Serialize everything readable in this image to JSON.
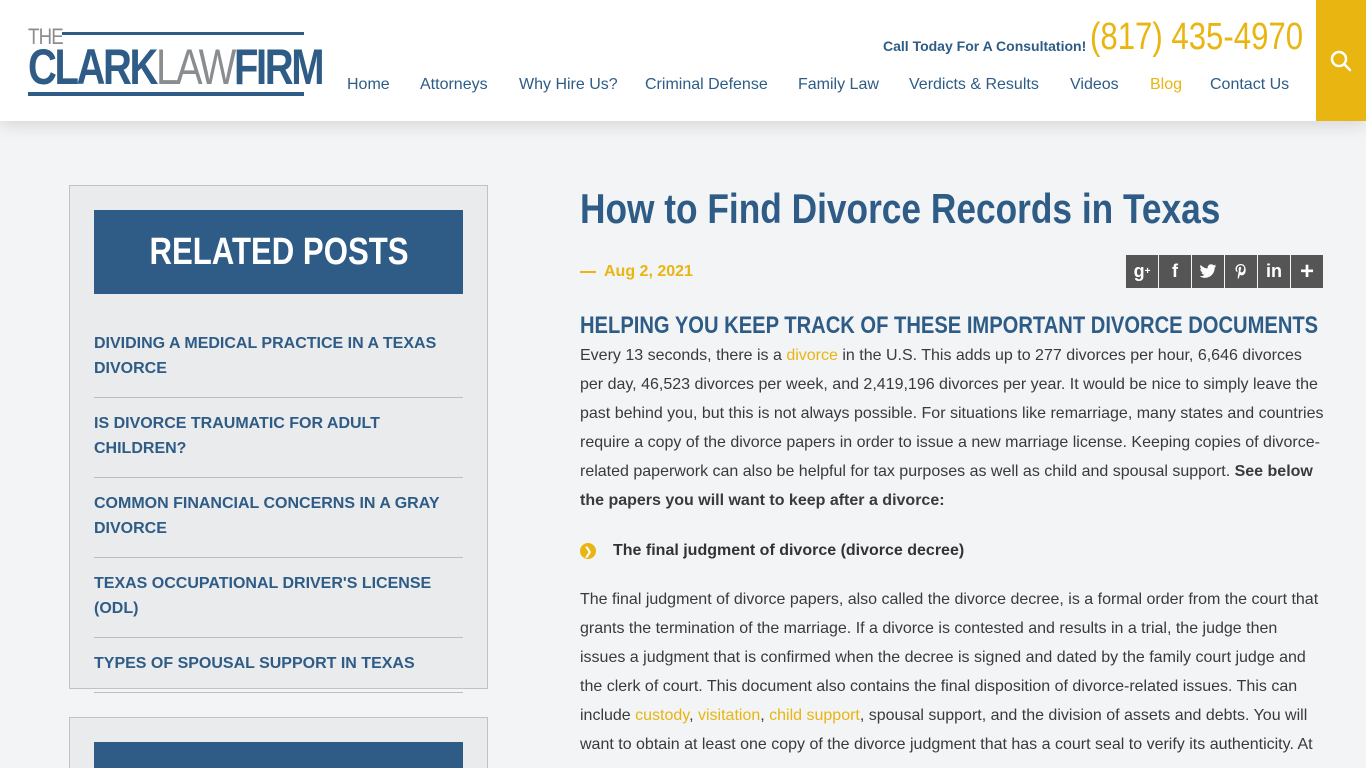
{
  "header": {
    "logo": {
      "the": "THE",
      "clark": "CLARK",
      "law": "LAW",
      "firm": "FIRM"
    },
    "cta_text": "Call Today For A Consultation!",
    "phone": "(817) 435-4970",
    "nav": [
      "Home",
      "Attorneys",
      "Why Hire Us?",
      "Criminal Defense",
      "Family Law",
      "Verdicts & Results",
      "Videos",
      "Blog",
      "Contact Us"
    ],
    "active_nav": "Blog",
    "search_icon": "search-icon"
  },
  "sidebar": {
    "title": "RELATED POSTS",
    "posts": [
      "DIVIDING A MEDICAL PRACTICE IN A TEXAS DIVORCE",
      "IS DIVORCE TRAUMATIC FOR ADULT CHILDREN?",
      "COMMON FINANCIAL CONCERNS IN A GRAY DIVORCE",
      "TEXAS OCCUPATIONAL DRIVER'S LICENSE (ODL)",
      "TYPES OF SPOUSAL SUPPORT IN TEXAS"
    ]
  },
  "article": {
    "title": "How to Find Divorce Records in Texas",
    "date": "Aug 2, 2021",
    "share_icons": [
      "google-plus-icon",
      "facebook-icon",
      "twitter-icon",
      "pinterest-icon",
      "linkedin-icon",
      "plus-icon"
    ],
    "subheading": "HELPING YOU KEEP TRACK OF THESE IMPORTANT DIVORCE DOCUMENTS",
    "p1_a": "Every 13 seconds, there is a ",
    "p1_link": "divorce",
    "p1_b": " in the U.S. This adds up to 277 divorces per hour, 6,646 divorces per day, 46,523 divorces per week, and 2,419,196 divorces per year. It would be nice to simply leave the past behind you, but this is not always possible. For situations like remarriage, many states and countries require a copy of the divorce papers in order to issue a new marriage license. Keeping copies of divorce-related paperwork can also be helpful for tax purposes as well as child and spousal support. ",
    "p1_bold": "See below the papers you will want to keep after a divorce:",
    "bullet": "The final judgment of divorce (divorce decree)",
    "p2_a": "The final judgment of divorce papers, also called the divorce decree, is a formal order from the court that grants the termination of the marriage. If a divorce is contested and results in a trial, the judge then issues a judgment that is confirmed when the decree is signed and dated by the family court judge and the clerk of court. This document also contains the final disposition of divorce-related issues. This can include ",
    "p2_link1": "custody",
    "p2_sep1": ", ",
    "p2_link2": "visitation",
    "p2_sep2": ", ",
    "p2_link3": "child support",
    "p2_b": ", spousal support, and the division of assets and debts. You will want to obtain at least one copy of the divorce judgment that has a court seal to verify its authenticity. At"
  },
  "colors": {
    "brand_blue": "#2e5c86",
    "accent_gold": "#e8b511",
    "gray": "#8a8d90"
  }
}
